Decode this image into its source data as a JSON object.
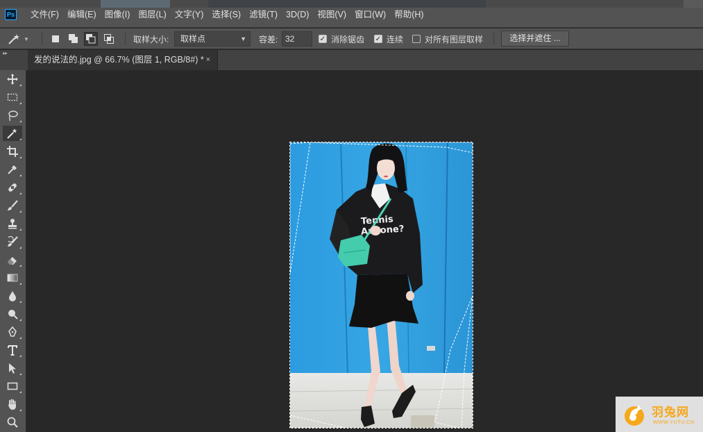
{
  "app": {
    "logo_text": "Ps"
  },
  "menu": [
    "文件(F)",
    "编辑(E)",
    "图像(I)",
    "图层(L)",
    "文字(Y)",
    "选择(S)",
    "滤镜(T)",
    "3D(D)",
    "视图(V)",
    "窗口(W)",
    "帮助(H)"
  ],
  "options": {
    "sample_size_label": "取样大小:",
    "sample_size_value": "取样点",
    "tolerance_label": "容差:",
    "tolerance_value": "32",
    "anti_alias_label": "消除锯齿",
    "anti_alias_checked": true,
    "contiguous_label": "连续",
    "contiguous_checked": true,
    "sample_all_layers_label": "对所有图层取样",
    "sample_all_layers_checked": false,
    "select_and_mask_label": "选择并遮住 ..."
  },
  "document_tab": {
    "title": "发的说法的.jpg @ 66.7% (图层 1, RGB/8#) *",
    "close": "×"
  },
  "tools": [
    "move-tool",
    "rectangular-marquee-tool",
    "lasso-tool",
    "magic-wand-tool",
    "crop-tool",
    "eyedropper-tool",
    "healing-brush-tool",
    "brush-tool",
    "clone-stamp-tool",
    "history-brush-tool",
    "eraser-tool",
    "gradient-tool",
    "blur-tool",
    "dodge-tool",
    "pen-tool",
    "type-tool",
    "path-selection-tool",
    "rectangle-tool",
    "hand-tool",
    "zoom-tool"
  ],
  "active_tool": "magic-wand-tool",
  "photo_text": {
    "shirt_line1": "Tennis",
    "shirt_line2": "Anyone?"
  },
  "watermark": {
    "name": "羽兔网",
    "url": "WWW.YUTU.CN"
  },
  "colors": {
    "accent": "#31a8ff",
    "wall_blue": "#2f9fdc",
    "watermark": "#f5a81c"
  }
}
